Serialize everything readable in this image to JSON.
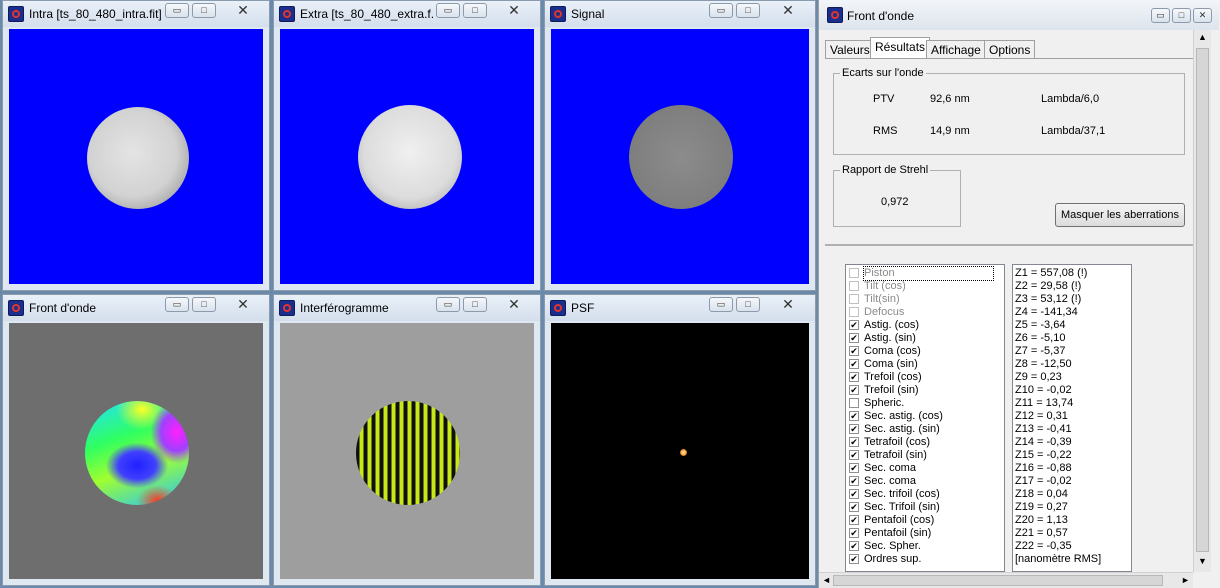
{
  "windows": {
    "intra": {
      "title": "Intra [ts_80_480_intra.fit]"
    },
    "extra": {
      "title": "Extra [ts_80_480_extra.f..."
    },
    "signal": {
      "title": "Signal"
    },
    "front": {
      "title": "Front d'onde"
    },
    "interf": {
      "title": "Interférogramme"
    },
    "psf": {
      "title": "PSF"
    }
  },
  "controls": {
    "minimize": "▭",
    "maximize": "□",
    "close": "✕"
  },
  "panel": {
    "title": "Front d'onde",
    "tabs": [
      "Valeurs",
      "Résultats",
      "Affichage",
      "Options"
    ],
    "active_tab": "Résultats",
    "ecarts": {
      "label": "Ecarts sur l'onde",
      "ptv": {
        "label": "PTV",
        "value": "92,6 nm",
        "lambda": "Lambda/6,0"
      },
      "rms": {
        "label": "RMS",
        "value": "14,9 nm",
        "lambda": "Lambda/37,1"
      }
    },
    "strehl": {
      "label": "Rapport de Strehl",
      "value": "0,972"
    },
    "mask_button": "Masquer les aberrations",
    "aberrations": [
      {
        "label": "Piston",
        "checked": false,
        "disabled": true
      },
      {
        "label": "Tilt (cos)",
        "checked": false,
        "disabled": true
      },
      {
        "label": "Tilt(sin)",
        "checked": false,
        "disabled": true
      },
      {
        "label": "Defocus",
        "checked": false,
        "disabled": true
      },
      {
        "label": "Astig. (cos)",
        "checked": true,
        "disabled": false
      },
      {
        "label": "Astig. (sin)",
        "checked": true,
        "disabled": false
      },
      {
        "label": "Coma (cos)",
        "checked": true,
        "disabled": false
      },
      {
        "label": "Coma (sin)",
        "checked": true,
        "disabled": false
      },
      {
        "label": "Trefoil (cos)",
        "checked": true,
        "disabled": false
      },
      {
        "label": "Trefoil (sin)",
        "checked": true,
        "disabled": false
      },
      {
        "label": "Spheric.",
        "checked": false,
        "disabled": false
      },
      {
        "label": "Sec. astig. (cos)",
        "checked": true,
        "disabled": false
      },
      {
        "label": "Sec. astig. (sin)",
        "checked": true,
        "disabled": false
      },
      {
        "label": "Tetrafoil (cos)",
        "checked": true,
        "disabled": false
      },
      {
        "label": "Tetrafoil (sin)",
        "checked": true,
        "disabled": false
      },
      {
        "label": "Sec. coma",
        "checked": true,
        "disabled": false
      },
      {
        "label": "Sec. coma",
        "checked": true,
        "disabled": false
      },
      {
        "label": "Sec. trifoil (cos)",
        "checked": true,
        "disabled": false
      },
      {
        "label": "Sec. Trifoil (sin)",
        "checked": true,
        "disabled": false
      },
      {
        "label": "Pentafoil (cos)",
        "checked": true,
        "disabled": false
      },
      {
        "label": "Pentafoil (sin)",
        "checked": true,
        "disabled": false
      },
      {
        "label": "Sec. Spher.",
        "checked": true,
        "disabled": false
      },
      {
        "label": "Ordres sup.",
        "checked": true,
        "disabled": false
      }
    ],
    "zernike": [
      "Z1 = 557,08  (!)",
      "Z2 = 29,58  (!)",
      "Z3 = 53,12  (!)",
      "Z4 = -141,34",
      "Z5 = -3,64",
      "Z6 = -5,10",
      "Z7 = -5,37",
      "Z8 = -12,50",
      "Z9 = 0,23",
      "Z10 = -0,02",
      "Z11 = 13,74",
      "Z12 = 0,31",
      "Z13 = -0,41",
      "Z14 = -0,39",
      "Z15 = -0,22",
      "Z16 = -0,88",
      "Z17 = -0,02",
      "Z18 = 0,04",
      "Z19 = 0,27",
      "Z20 = 1,13",
      "Z21 = 0,57",
      "Z22 = -0,35",
      "[nanomètre RMS]"
    ],
    "scroll_up": "▲",
    "scroll_down": "▼",
    "scroll_left": "◄",
    "scroll_right": "►"
  },
  "colors": {
    "image_bg": "#0000ff",
    "psf_spot": "#ff9a2a"
  }
}
